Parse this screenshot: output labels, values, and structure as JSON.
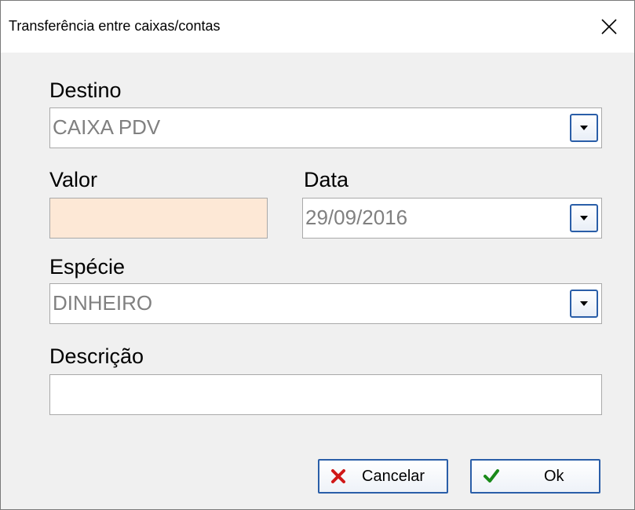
{
  "window": {
    "title": "Transferência entre caixas/contas"
  },
  "form": {
    "destino": {
      "label": "Destino",
      "value": "CAIXA PDV"
    },
    "valor": {
      "label": "Valor",
      "value": ""
    },
    "data": {
      "label": "Data",
      "value": "29/09/2016"
    },
    "especie": {
      "label": "Espécie",
      "value": "DINHEIRO"
    },
    "descricao": {
      "label": "Descrição",
      "value": ""
    }
  },
  "buttons": {
    "cancel_label": "Cancelar",
    "ok_label": "Ok"
  },
  "icons": {
    "close": "close-icon",
    "dropdown": "chevron-down-icon",
    "cancel": "x-icon",
    "ok": "checkmark-icon"
  },
  "colors": {
    "valor_background": "#fde8d6",
    "button_border": "#2a5ea8",
    "cancel_icon": "#d01818",
    "ok_icon": "#1a8a1a"
  }
}
